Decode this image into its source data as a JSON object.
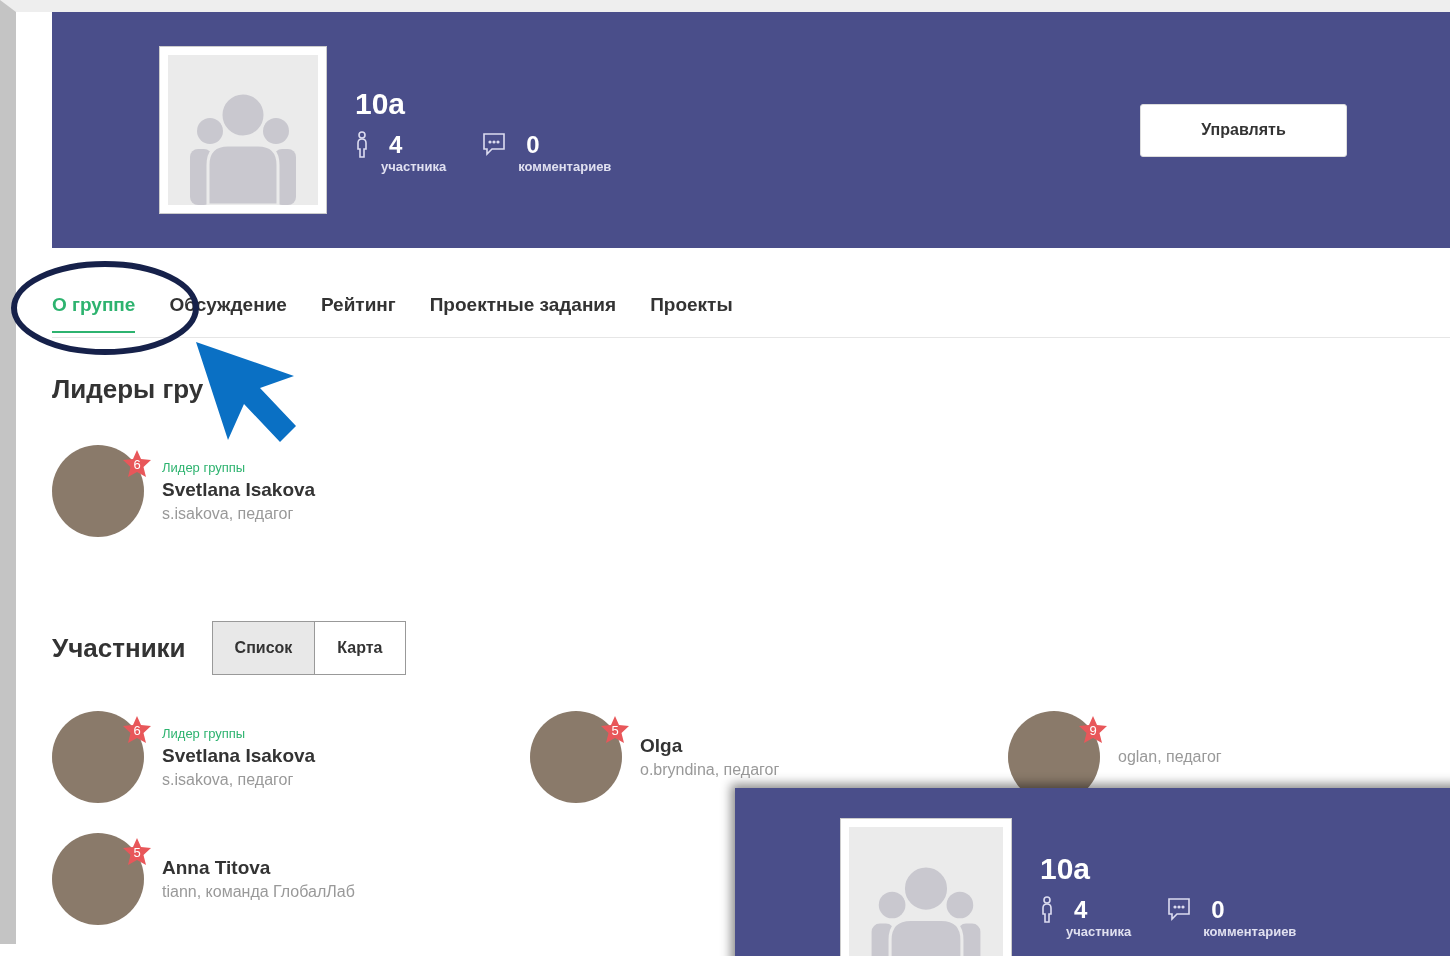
{
  "header": {
    "title": "10a",
    "members_count": "4",
    "members_label": "участника",
    "comments_count": "0",
    "comments_label": "комментариев",
    "manage_button": "Управлять"
  },
  "tabs": [
    {
      "label": "О группе",
      "selected": true
    },
    {
      "label": "Обсуждение",
      "selected": false
    },
    {
      "label": "Рейтинг",
      "selected": false
    },
    {
      "label": "Проектные задания",
      "selected": false
    },
    {
      "label": "Проекты",
      "selected": false
    }
  ],
  "leaders": {
    "heading": "Лидеры гру",
    "items": [
      {
        "role": "Лидер группы",
        "name": "Svetlana Isakova",
        "subtitle": "s.isakova, педагог",
        "rank": "6"
      }
    ]
  },
  "members": {
    "heading": "Участники",
    "view_toggle": [
      {
        "label": "Список",
        "selected": true
      },
      {
        "label": "Карта",
        "selected": false
      }
    ],
    "items": [
      {
        "role": "Лидер группы",
        "name": "Svetlana Isakova",
        "subtitle": "s.isakova, педагог",
        "rank": "6"
      },
      {
        "name": "Olga",
        "subtitle": "o.bryndina, педагог",
        "rank": "5"
      },
      {
        "subtitle": "oglan, педагог",
        "rank": "9"
      },
      {
        "name": "Anna Titova",
        "subtitle": "tiann, команда ГлобалЛаб",
        "rank": "5"
      }
    ]
  },
  "inset_screenshot": {
    "title": "10a",
    "members_count": "4",
    "members_label": "участника",
    "comments_count": "0",
    "comments_label": "комментариев"
  }
}
